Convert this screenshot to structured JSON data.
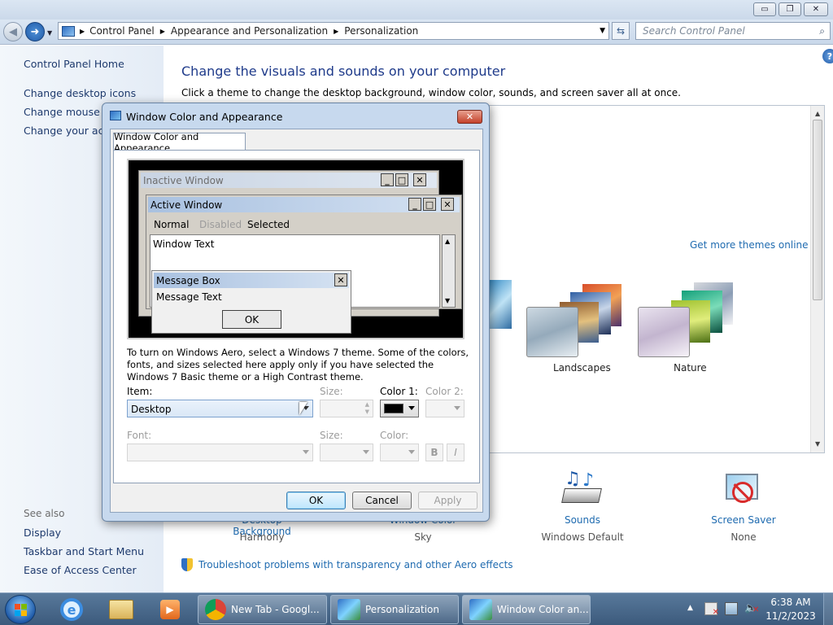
{
  "window": {
    "minimize": "▭",
    "maximize": "❐",
    "close": "✕"
  },
  "nav": {
    "back_icon": "◀",
    "forward_icon": "➜",
    "breadcrumb": [
      "Control Panel",
      "Appearance and Personalization",
      "Personalization"
    ],
    "search_placeholder": "Search Control Panel"
  },
  "left": {
    "home": "Control Panel Home",
    "links": [
      "Change desktop icons",
      "Change mouse pointers",
      "Change your account picture"
    ],
    "see_also_title": "See also",
    "see_also": [
      "Display",
      "Taskbar and Start Menu",
      "Ease of Access Center"
    ]
  },
  "main": {
    "heading": "Change the visuals and sounds on your computer",
    "subheading": "Click a theme to change the desktop background, window color, sounds, and screen saver all at once.",
    "get_more": "Get more themes online",
    "themes": [
      {
        "name": "Landscapes"
      },
      {
        "name": "Nature"
      }
    ],
    "bottom": [
      {
        "label": "Desktop Background",
        "value": "Harmony"
      },
      {
        "label": "Window Color",
        "value": "Sky"
      },
      {
        "label": "Sounds",
        "value": "Windows Default"
      },
      {
        "label": "Screen Saver",
        "value": "None"
      }
    ],
    "troubleshoot": "Troubleshoot problems with transparency and other Aero effects"
  },
  "dialog": {
    "title": "Window Color and Appearance",
    "tab": "Window Color and Appearance",
    "preview": {
      "inactive": "Inactive Window",
      "active": "Active Window",
      "menu": [
        "Normal",
        "Disabled",
        "Selected"
      ],
      "window_text": "Window Text",
      "msgbox": "Message Box",
      "msgtext": "Message Text",
      "ok": "OK"
    },
    "info": "To turn on Windows Aero, select a Windows 7 theme.  Some of the colors, fonts, and sizes selected here apply only if you have selected the Windows 7 Basic theme or a High Contrast theme.",
    "item_label": "Item:",
    "item_value": "Desktop",
    "size_label": "Size:",
    "color1_label": "Color 1:",
    "color2_label": "Color 2:",
    "font_label": "Font:",
    "size2_label": "Size:",
    "color_label": "Color:",
    "bold": "B",
    "italic": "I",
    "ok": "OK",
    "cancel": "Cancel",
    "apply": "Apply",
    "color1_hex": "#000000"
  },
  "taskbar": {
    "tasks": [
      {
        "label": "New Tab - Googl..."
      },
      {
        "label": "Personalization"
      },
      {
        "label": "Window Color an..."
      }
    ],
    "time": "6:38 AM",
    "date": "11/2/2023"
  }
}
